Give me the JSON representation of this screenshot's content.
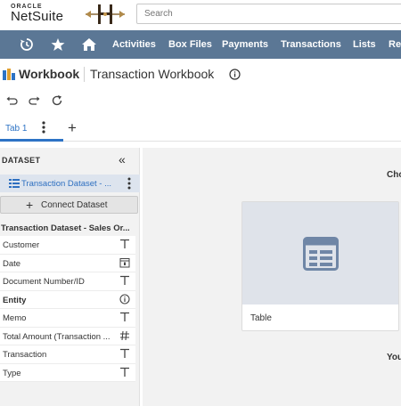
{
  "brand": {
    "small": "ORACLE",
    "main": "NetSuite"
  },
  "search": {
    "placeholder": "Search"
  },
  "nav": {
    "icons": [
      "history-icon",
      "star-icon",
      "home-icon"
    ],
    "items": [
      "Activities",
      "Box Files",
      "Payments",
      "Transactions",
      "Lists",
      "Re"
    ]
  },
  "header": {
    "title": "Workbook",
    "subtitle": "Transaction Workbook"
  },
  "tabs": [
    {
      "label": "Tab 1"
    }
  ],
  "panel": {
    "header": "DATASET",
    "dataset_label": "Transaction Dataset - ...",
    "connect_label": "Connect Dataset",
    "fields_title": "Transaction Dataset - Sales Or...",
    "fields": [
      {
        "name": "Customer",
        "type": "text",
        "bold": false
      },
      {
        "name": "Date",
        "type": "date",
        "bold": false
      },
      {
        "name": "Document Number/ID",
        "type": "text",
        "bold": false
      },
      {
        "name": "Entity",
        "type": "info",
        "bold": true
      },
      {
        "name": "Memo",
        "type": "text",
        "bold": false
      },
      {
        "name": "Total Amount (Transaction ...",
        "type": "number",
        "bold": false
      },
      {
        "name": "Transaction",
        "type": "text",
        "bold": false
      },
      {
        "name": "Type",
        "type": "text",
        "bold": false
      }
    ]
  },
  "canvas": {
    "choose_text": "Cho",
    "card_label": "Table",
    "you_text": "You"
  },
  "colors": {
    "nav_bg": "#5b7795",
    "accent": "#2d73c5",
    "panel_bg": "#f2f2f2"
  }
}
